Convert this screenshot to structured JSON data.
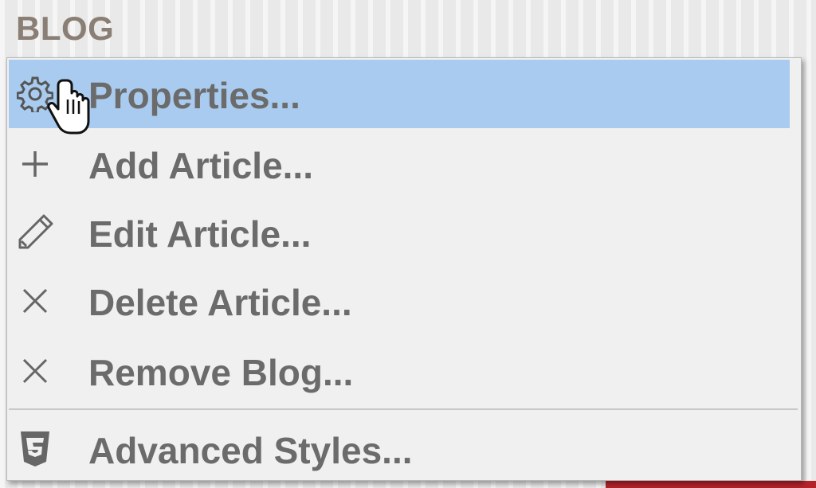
{
  "section": {
    "title": "BLOG"
  },
  "menu": {
    "items": [
      {
        "label": "Properties...",
        "icon": "gear-icon",
        "highlighted": true
      },
      {
        "label": "Add Article...",
        "icon": "plus-icon",
        "highlighted": false
      },
      {
        "label": "Edit Article...",
        "icon": "pencil-icon",
        "highlighted": false
      },
      {
        "label": "Delete Article...",
        "icon": "x-icon",
        "highlighted": false
      },
      {
        "label": "Remove Blog...",
        "icon": "x-icon",
        "highlighted": false
      },
      {
        "label": "Advanced Styles...",
        "icon": "css3-icon",
        "highlighted": false
      }
    ]
  },
  "colors": {
    "highlight": "#a8cbef",
    "menu_background": "#f0f0f0",
    "label_text": "#6b6b6b",
    "section_title": "#8a7f74"
  }
}
